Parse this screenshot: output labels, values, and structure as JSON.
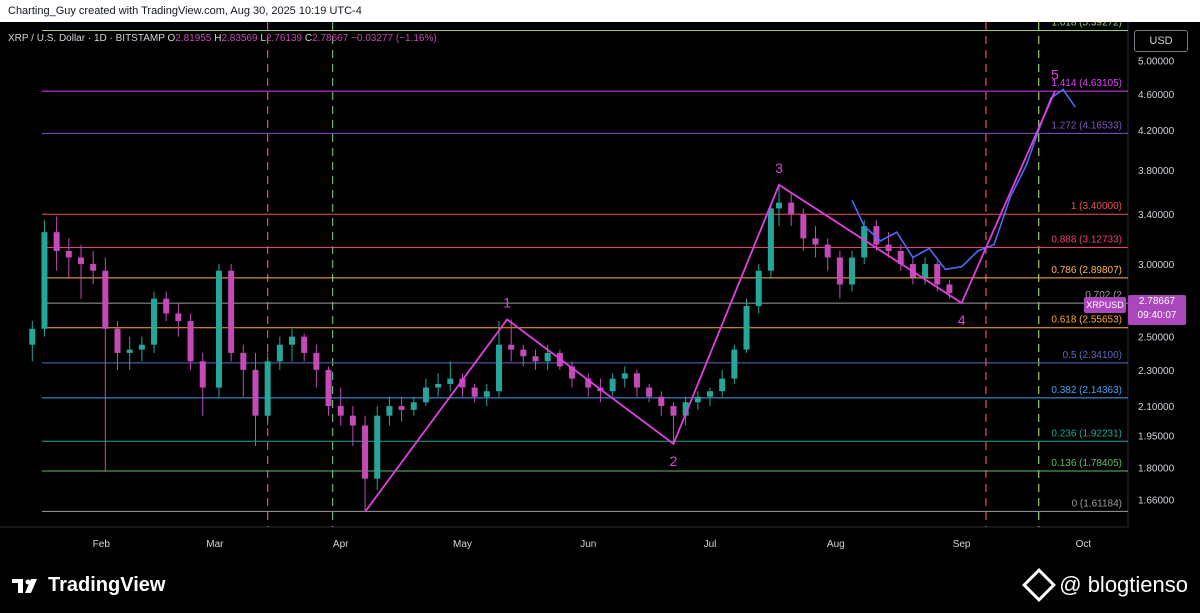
{
  "header": {
    "attribution": "Charting_Guy created with TradingView.com, Aug 30, 2025 10:19 UTC-4"
  },
  "legend": {
    "symbol": "XRP / U.S. Dollar · 1D · BITSTAMP",
    "open_label": "O",
    "open": "2.81955",
    "high_label": "H",
    "high": "2.83569",
    "low_label": "L",
    "low": "2.76139",
    "close_label": "C",
    "close": "2.78667",
    "change": "−0.03277 (−1.16%)"
  },
  "currency": "USD",
  "price_badge": {
    "symbol": "XRPUSD",
    "price": "2.78667",
    "countdown": "09:40:07"
  },
  "footer": {
    "brand": "TradingView",
    "watermark": "@ blogtienso"
  },
  "colors": {
    "background": "#000000",
    "candle_up": "#26a69a",
    "candle_down": "#c44ab8",
    "wave": "#e040e0",
    "projection": "#4a6cf7"
  },
  "chart_data": {
    "type": "candlestick",
    "scale": "log",
    "ylim": [
      1.55,
      5.4
    ],
    "y_ticks": [
      "5.00000",
      "4.60000",
      "4.20000",
      "3.80000",
      "3.40000",
      "3.00000",
      "2.50000",
      "2.30000",
      "2.10000",
      "1.95000",
      "1.80000",
      "1.66000"
    ],
    "x_ticks": [
      "Feb",
      "Mar",
      "Apr",
      "May",
      "Jun",
      "Jul",
      "Aug",
      "Sep",
      "Oct"
    ],
    "fib_levels": [
      {
        "ratio": "1.618",
        "price": 5.39272,
        "label": "1.618 (5.39272)",
        "color": "#9ccc65"
      },
      {
        "ratio": "1.414",
        "price": 4.63105,
        "label": "1.414 (4.63105)",
        "color": "#e040fb"
      },
      {
        "ratio": "1.272",
        "price": 4.16533,
        "label": "1.272 (4.16533)",
        "color": "#7e57c2"
      },
      {
        "ratio": "1",
        "price": 3.4,
        "label": "1 (3.40000)",
        "color": "#ef5350"
      },
      {
        "ratio": "0.888",
        "price": 3.12733,
        "label": "0.888 (3.12733)",
        "color": "#ec407a"
      },
      {
        "ratio": "0.786",
        "price": 2.89807,
        "label": "0.786 (2.89807)",
        "color": "#ffb74d"
      },
      {
        "ratio": "0.702",
        "price": 2.72,
        "label": "0.702 (2",
        "color": "#9e9e9e"
      },
      {
        "ratio": "0.618",
        "price": 2.55653,
        "label": "0.618 (2.55653)",
        "color": "#ffa726"
      },
      {
        "ratio": "0.5",
        "price": 2.341,
        "label": "0.5 (2.34100)",
        "color": "#5c6bc0"
      },
      {
        "ratio": "0.382",
        "price": 2.14363,
        "label": "0.382 (2.14363)",
        "color": "#42a5f5"
      },
      {
        "ratio": "0.236",
        "price": 1.92231,
        "label": "0.236 (1.92231)",
        "color": "#26a69a"
      },
      {
        "ratio": "0.136",
        "price": 1.78405,
        "label": "0.136 (1.78405)",
        "color": "#66bb6a"
      },
      {
        "ratio": "0",
        "price": 1.61184,
        "label": "0 (1.61184)",
        "color": "#9e9e9e"
      }
    ],
    "waves": [
      {
        "label": "",
        "date": "Apr 7",
        "price": 1.61
      },
      {
        "label": "1",
        "date": "May 12",
        "price": 2.61
      },
      {
        "label": "2",
        "date": "Jun 22",
        "price": 1.91
      },
      {
        "label": "3",
        "date": "Jul 18",
        "price": 3.66
      },
      {
        "label": "4",
        "date": "Sep 1",
        "price": 2.72
      },
      {
        "label": "5",
        "date": "Sep 24",
        "price": 4.63
      }
    ],
    "projection": [
      [
        "Aug 5",
        3.52
      ],
      [
        "Aug 8",
        3.3
      ],
      [
        "Aug 12",
        3.18
      ],
      [
        "Aug 16",
        3.25
      ],
      [
        "Aug 20",
        3.05
      ],
      [
        "Aug 24",
        3.12
      ],
      [
        "Aug 28",
        2.96
      ],
      [
        "Sep 1",
        2.98
      ],
      [
        "Sep 5",
        3.1
      ],
      [
        "Sep 9",
        3.15
      ],
      [
        "Sep 13",
        3.55
      ],
      [
        "Sep 17",
        3.85
      ],
      [
        "Sep 20",
        4.2
      ],
      [
        "Sep 23",
        4.55
      ],
      [
        "Sep 26",
        4.65
      ],
      [
        "Sep 29",
        4.45
      ]
    ],
    "ohlc": [
      [
        "Jan 15",
        2.45,
        2.6,
        2.35,
        2.55
      ],
      [
        "Jan 18",
        2.55,
        3.35,
        2.5,
        3.25
      ],
      [
        "Jan 21",
        3.25,
        3.38,
        2.95,
        3.1
      ],
      [
        "Jan 24",
        3.1,
        3.2,
        2.9,
        3.05
      ],
      [
        "Jan 27",
        3.05,
        3.15,
        2.75,
        3.0
      ],
      [
        "Jan 30",
        3.0,
        3.1,
        2.85,
        2.95
      ],
      [
        "Feb 2",
        2.95,
        3.05,
        1.78,
        2.55
      ],
      [
        "Feb 5",
        2.55,
        2.6,
        2.3,
        2.4
      ],
      [
        "Feb 8",
        2.4,
        2.5,
        2.3,
        2.42
      ],
      [
        "Feb 11",
        2.42,
        2.5,
        2.35,
        2.45
      ],
      [
        "Feb 14",
        2.45,
        2.8,
        2.4,
        2.75
      ],
      [
        "Feb 17",
        2.75,
        2.8,
        2.6,
        2.65
      ],
      [
        "Feb 20",
        2.65,
        2.72,
        2.5,
        2.6
      ],
      [
        "Feb 23",
        2.6,
        2.65,
        2.3,
        2.35
      ],
      [
        "Feb 26",
        2.35,
        2.4,
        2.05,
        2.2
      ],
      [
        "Mar 2",
        2.2,
        3.0,
        2.15,
        2.95
      ],
      [
        "Mar 5",
        2.95,
        3.0,
        2.35,
        2.4
      ],
      [
        "Mar 8",
        2.4,
        2.45,
        2.15,
        2.3
      ],
      [
        "Mar 11",
        2.3,
        2.4,
        1.9,
        2.05
      ],
      [
        "Mar 14",
        2.05,
        2.4,
        2.0,
        2.35
      ],
      [
        "Mar 17",
        2.35,
        2.5,
        2.3,
        2.45
      ],
      [
        "Mar 20",
        2.45,
        2.55,
        2.35,
        2.5
      ],
      [
        "Mar 23",
        2.5,
        2.52,
        2.35,
        2.4
      ],
      [
        "Mar 26",
        2.4,
        2.45,
        2.2,
        2.3
      ],
      [
        "Mar 29",
        2.3,
        2.32,
        2.05,
        2.1
      ],
      [
        "Apr 1",
        2.1,
        2.2,
        2.0,
        2.05
      ],
      [
        "Apr 4",
        2.05,
        2.1,
        1.9,
        2.0
      ],
      [
        "Apr 7",
        2.0,
        2.05,
        1.61,
        1.75
      ],
      [
        "Apr 10",
        1.75,
        2.1,
        1.7,
        2.05
      ],
      [
        "Apr 13",
        2.05,
        2.15,
        2.0,
        2.1
      ],
      [
        "Apr 16",
        2.1,
        2.15,
        2.02,
        2.08
      ],
      [
        "Apr 19",
        2.08,
        2.15,
        2.05,
        2.12
      ],
      [
        "Apr 22",
        2.12,
        2.25,
        2.1,
        2.2
      ],
      [
        "Apr 25",
        2.2,
        2.28,
        2.15,
        2.22
      ],
      [
        "Apr 28",
        2.22,
        2.35,
        2.18,
        2.25
      ],
      [
        "May 1",
        2.25,
        2.28,
        2.15,
        2.2
      ],
      [
        "May 4",
        2.2,
        2.22,
        2.12,
        2.15
      ],
      [
        "May 7",
        2.15,
        2.22,
        2.1,
        2.18
      ],
      [
        "May 10",
        2.18,
        2.6,
        2.15,
        2.45
      ],
      [
        "May 13",
        2.45,
        2.61,
        2.35,
        2.42
      ],
      [
        "May 16",
        2.42,
        2.45,
        2.32,
        2.38
      ],
      [
        "May 19",
        2.38,
        2.42,
        2.3,
        2.35
      ],
      [
        "May 22",
        2.35,
        2.45,
        2.3,
        2.4
      ],
      [
        "May 25",
        2.4,
        2.42,
        2.3,
        2.32
      ],
      [
        "May 28",
        2.32,
        2.35,
        2.2,
        2.25
      ],
      [
        "Jun 1",
        2.25,
        2.28,
        2.15,
        2.2
      ],
      [
        "Jun 4",
        2.2,
        2.25,
        2.12,
        2.18
      ],
      [
        "Jun 7",
        2.18,
        2.28,
        2.15,
        2.25
      ],
      [
        "Jun 10",
        2.25,
        2.32,
        2.2,
        2.28
      ],
      [
        "Jun 13",
        2.28,
        2.3,
        2.15,
        2.2
      ],
      [
        "Jun 16",
        2.2,
        2.22,
        2.12,
        2.15
      ],
      [
        "Jun 19",
        2.15,
        2.18,
        2.05,
        2.1
      ],
      [
        "Jun 22",
        2.1,
        2.12,
        1.91,
        2.05
      ],
      [
        "Jun 25",
        2.05,
        2.15,
        2.0,
        2.12
      ],
      [
        "Jun 28",
        2.12,
        2.18,
        2.08,
        2.15
      ],
      [
        "Jul 1",
        2.15,
        2.2,
        2.1,
        2.18
      ],
      [
        "Jul 4",
        2.18,
        2.3,
        2.15,
        2.25
      ],
      [
        "Jul 7",
        2.25,
        2.45,
        2.22,
        2.42
      ],
      [
        "Jul 10",
        2.42,
        2.75,
        2.4,
        2.7
      ],
      [
        "Jul 13",
        2.7,
        3.0,
        2.65,
        2.95
      ],
      [
        "Jul 16",
        2.95,
        3.5,
        2.9,
        3.45
      ],
      [
        "Jul 18",
        3.45,
        3.66,
        3.3,
        3.5
      ],
      [
        "Jul 21",
        3.5,
        3.58,
        3.3,
        3.4
      ],
      [
        "Jul 24",
        3.4,
        3.45,
        3.1,
        3.2
      ],
      [
        "Jul 27",
        3.2,
        3.3,
        3.05,
        3.15
      ],
      [
        "Jul 30",
        3.15,
        3.2,
        2.95,
        3.05
      ],
      [
        "Aug 2",
        3.05,
        3.1,
        2.75,
        2.85
      ],
      [
        "Aug 5",
        2.85,
        3.1,
        2.8,
        3.05
      ],
      [
        "Aug 8",
        3.05,
        3.35,
        3.0,
        3.3
      ],
      [
        "Aug 11",
        3.3,
        3.35,
        3.1,
        3.15
      ],
      [
        "Aug 14",
        3.15,
        3.25,
        3.05,
        3.1
      ],
      [
        "Aug 17",
        3.1,
        3.15,
        2.95,
        3.0
      ],
      [
        "Aug 20",
        3.0,
        3.05,
        2.85,
        2.9
      ],
      [
        "Aug 23",
        2.9,
        3.05,
        2.85,
        3.0
      ],
      [
        "Aug 26",
        3.0,
        3.02,
        2.8,
        2.85
      ],
      [
        "Aug 29",
        2.85,
        2.88,
        2.75,
        2.79
      ]
    ]
  }
}
